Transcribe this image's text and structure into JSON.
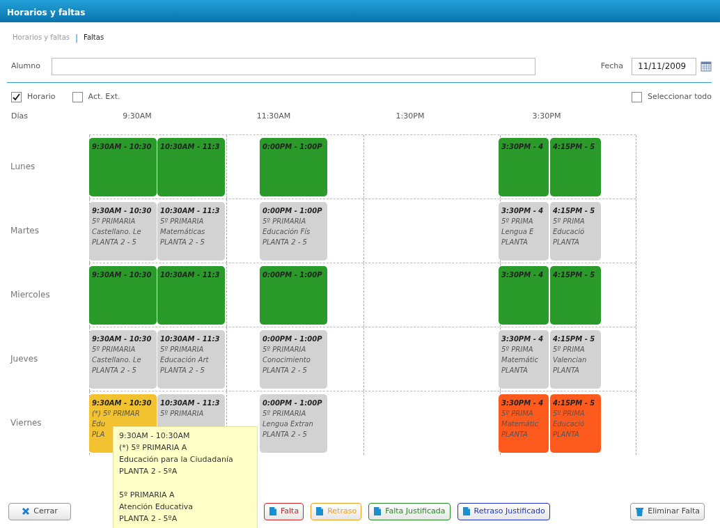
{
  "window": {
    "title": "Horarios y faltas"
  },
  "breadcrumb": {
    "items": [
      {
        "label": "Horarios y faltas",
        "selected": false
      },
      {
        "label": "Faltas",
        "selected": true
      }
    ],
    "separator": "|"
  },
  "student": {
    "label": "Alumno"
  },
  "date": {
    "label": "Fecha",
    "value": "11/11/2009"
  },
  "filters": [
    {
      "label": "Horario",
      "checked": true
    },
    {
      "label": "Act. Ext.",
      "checked": false
    }
  ],
  "select_all": {
    "label": "Seleccionar todo",
    "checked": false
  },
  "grid": {
    "days_label": "Días",
    "times": [
      "9:30AM",
      "11:30AM",
      "1:30PM",
      "3:30PM"
    ],
    "days": [
      {
        "name": "Lunes",
        "blocks": [
          {
            "color": "#2a9a2a",
            "lines": [
              "9:30AM - 10:30"
            ]
          },
          {
            "color": "#2a9a2a",
            "lines": [
              "10:30AM - 11:3"
            ]
          },
          {
            "color": "#2a9a2a",
            "lines": [
              "0:00PM - 1:00P"
            ]
          },
          {
            "color": "#2a9a2a",
            "lines": [
              "3:30PM - 4"
            ]
          },
          {
            "color": "#2a9a2a",
            "lines": [
              "4:15PM - 5"
            ]
          }
        ]
      },
      {
        "name": "Martes",
        "blocks": [
          {
            "color": "#d2d2d2",
            "lines": [
              "9:30AM - 10:30",
              "5º PRIMARIA",
              "Castellano. Le",
              "PLANTA 2 - 5"
            ]
          },
          {
            "color": "#d2d2d2",
            "lines": [
              "10:30AM - 11:3",
              "5º PRIMARIA",
              "Matemáticas",
              "PLANTA 2 - 5"
            ]
          },
          {
            "color": "#d2d2d2",
            "lines": [
              "0:00PM - 1:00P",
              "5º PRIMARIA",
              "Educación Fís",
              "PLANTA 2 - 5"
            ]
          },
          {
            "color": "#d2d2d2",
            "lines": [
              "3:30PM - 4",
              "5º PRIMA",
              "Lengua E",
              "PLANTA"
            ]
          },
          {
            "color": "#d2d2d2",
            "lines": [
              "4:15PM - 5",
              "5º PRIMA",
              "Educació",
              "PLANTA"
            ]
          }
        ]
      },
      {
        "name": "Miercoles",
        "blocks": [
          {
            "color": "#2a9a2a",
            "lines": [
              "9:30AM - 10:30"
            ]
          },
          {
            "color": "#2a9a2a",
            "lines": [
              "10:30AM - 11:3"
            ]
          },
          {
            "color": "#2a9a2a",
            "lines": [
              "0:00PM - 1:00P"
            ]
          },
          {
            "color": "#2a9a2a",
            "lines": [
              "3:30PM - 4"
            ]
          },
          {
            "color": "#2a9a2a",
            "lines": [
              "4:15PM - 5"
            ]
          }
        ]
      },
      {
        "name": "Jueves",
        "blocks": [
          {
            "color": "#d2d2d2",
            "lines": [
              "9:30AM - 10:30",
              "5º PRIMARIA",
              "Castellano. Le",
              "PLANTA 2 - 5"
            ]
          },
          {
            "color": "#d2d2d2",
            "lines": [
              "10:30AM - 11:3",
              "5º PRIMARIA",
              "Educación Art",
              "PLANTA 2 - 5"
            ]
          },
          {
            "color": "#d2d2d2",
            "lines": [
              "0:00PM - 1:00P",
              "5º PRIMARIA",
              "Conocimiento",
              "PLANTA 2 - 5"
            ]
          },
          {
            "color": "#d2d2d2",
            "lines": [
              "3:30PM - 4",
              "5º PRIMA",
              "Matemátic",
              "PLANTA"
            ]
          },
          {
            "color": "#d2d2d2",
            "lines": [
              "4:15PM - 5",
              "5º PRIMA",
              "Valencian",
              "PLANTA"
            ]
          }
        ]
      },
      {
        "name": "Viernes",
        "blocks": [
          {
            "color": "#f2c230",
            "lines": [
              "9:30AM - 10:30",
              "(*) 5º PRIMAR",
              "Edu",
              "PLA"
            ]
          },
          {
            "color": "#d2d2d2",
            "lines": [
              "10:30AM - 11:3",
              "5º PRIMARIA"
            ]
          },
          {
            "color": "#d2d2d2",
            "lines": [
              "0:00PM - 1:00P",
              "5º PRIMARIA",
              "Lengua Extran",
              "PLANTA 2 - 5"
            ]
          },
          {
            "color": "#ff5a1e",
            "lines": [
              "3:30PM - 4",
              "5º PRIMA",
              "Matemátic",
              "PLANTA"
            ]
          },
          {
            "color": "#ff5a1e",
            "lines": [
              "4:15PM - 5",
              "5º PRIMA",
              "Educació",
              "PLANTA"
            ]
          }
        ]
      }
    ]
  },
  "tooltip": {
    "groups": [
      [
        "9:30AM - 10:30AM",
        "(*) 5º PRIMARIA A",
        "Educación para la Ciudadanía",
        "PLANTA 2 - 5ºA"
      ],
      [
        "5º PRIMARIA A",
        "Atención Educativa",
        "PLANTA 2 - 5ºA"
      ]
    ]
  },
  "buttons": [
    {
      "kind": "close",
      "label": "Cerrar"
    },
    {
      "kind": "mark",
      "label": "Falta",
      "color": "#d42020"
    },
    {
      "kind": "mark",
      "label": "Retraso",
      "color": "#f0a020"
    },
    {
      "kind": "mark",
      "label": "Falta Justificada",
      "color": "#208a20"
    },
    {
      "kind": "mark",
      "label": "Retraso Justificado",
      "color": "#2030c0"
    },
    {
      "kind": "delete",
      "label": "Eliminar Falta"
    }
  ]
}
